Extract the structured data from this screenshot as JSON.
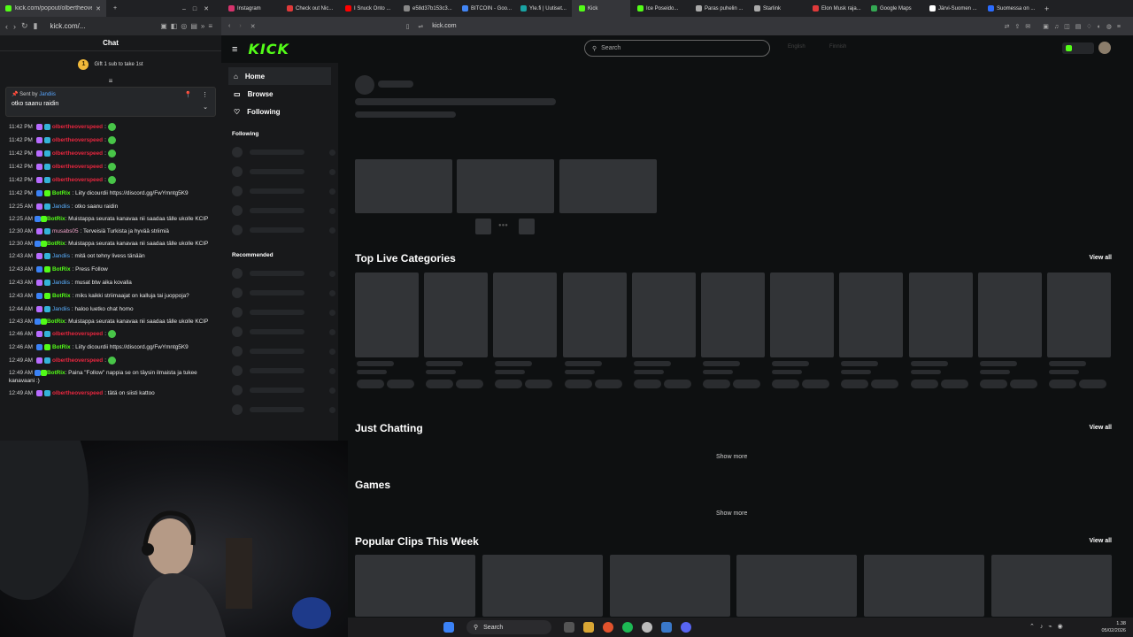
{
  "chat_window": {
    "tab_title": "kick.com/popout/olbertheovers...",
    "url": "kick.com/...",
    "title": "Chat",
    "gift_text": "Gift 1 sub to take 1st",
    "pinned": {
      "by_label": "Sent by",
      "by_user": "Jandiis",
      "message": "otko saanu raidin"
    },
    "messages": [
      {
        "time": "11:42 PM",
        "user": "olbertheoverspeed",
        "user_color": "red",
        "text": ":",
        "emote": true
      },
      {
        "time": "11:42 PM",
        "user": "olbertheoverspeed",
        "user_color": "red",
        "text": ":",
        "emote": true
      },
      {
        "time": "11:42 PM",
        "user": "olbertheoverspeed",
        "user_color": "red",
        "text": ":",
        "emote": true
      },
      {
        "time": "11:42 PM",
        "user": "olbertheoverspeed",
        "user_color": "red",
        "text": ":",
        "emote": true
      },
      {
        "time": "11:42 PM",
        "user": "olbertheoverspeed",
        "user_color": "red",
        "text": ":",
        "emote": true
      },
      {
        "time": "11:42 PM",
        "user": "BotRix",
        "user_color": "green",
        "text": ": Liity dicourdii https://discord.gg/FwYmntg5K9"
      },
      {
        "time": "12:25 AM",
        "user": "Jandiis",
        "user_color": "blue",
        "text": ": otko saanu raidin"
      },
      {
        "time": "12:25 AM",
        "user": "BotRix",
        "user_color": "green",
        "text": ": Muistappa seurata kanavaa nii saadaa tälle ukolle KCIP",
        "wrap": true
      },
      {
        "time": "12:30 AM",
        "user": "musabs05",
        "user_color": "pink",
        "text": ": Terveisiä Turkista ja hyvää striimiä"
      },
      {
        "time": "12:30 AM",
        "user": "BotRix",
        "user_color": "green",
        "text": ": Muistappa seurata kanavaa nii saadaa tälle ukolle KCIP",
        "wrap": true
      },
      {
        "time": "12:43 AM",
        "user": "Jandiis",
        "user_color": "blue",
        "text": ": mitä oot tehny livess tänään"
      },
      {
        "time": "12:43 AM",
        "user": "BotRix",
        "user_color": "green",
        "text": ": Press Follow"
      },
      {
        "time": "12:43 AM",
        "user": "Jandiis",
        "user_color": "blue",
        "text": ": musat btw aika kovalla"
      },
      {
        "time": "12:43 AM",
        "user": "BotRix",
        "user_color": "green",
        "text": ": miks kaikki striimaajat on kalluja tai juoppoja?"
      },
      {
        "time": "12:44 AM",
        "user": "Jandiis",
        "user_color": "blue",
        "text": ": haloo luetko chat homo"
      },
      {
        "time": "12:43 AM",
        "user": "BotRix",
        "user_color": "green",
        "text": ": Muistappa seurata kanavaa nii saadaa tälle ukolle KCIP",
        "wrap": true
      },
      {
        "time": "12:46 AM",
        "user": "olbertheoverspeed",
        "user_color": "red",
        "text": ":",
        "emote": true
      },
      {
        "time": "12:46 AM",
        "user": "BotRix",
        "user_color": "green",
        "text": ": Liity dicourdii https://discord.gg/FwYmntg5K9"
      },
      {
        "time": "12:49 AM",
        "user": "olbertheoverspeed",
        "user_color": "red",
        "text": ":",
        "emote": true
      },
      {
        "time": "12:49 AM",
        "user": "BotRix",
        "user_color": "green",
        "text": ": Paina \"Follow\" nappia se on täysin ilmaista ja tukee kanavaani :)",
        "wrap": true
      },
      {
        "time": "12:49 AM",
        "user": "olbertheoverspeed",
        "user_color": "red",
        "text": ": tätä on siisti kattoo"
      }
    ]
  },
  "browser": {
    "tabs": [
      {
        "label": "Instagram",
        "color": "#d6336c"
      },
      {
        "label": "Check out Nic...",
        "color": "#e03a3a"
      },
      {
        "label": "I Snuck Onto ...",
        "color": "#ff0000"
      },
      {
        "label": "e58d37b153c3...",
        "color": "#888888"
      },
      {
        "label": "BITCOIN - Goo...",
        "color": "#4285f4"
      },
      {
        "label": "Yle.fi | Uutiset...",
        "color": "#19a3a3"
      },
      {
        "label": "Kick",
        "color": "#53fc18",
        "active": true
      },
      {
        "label": "Ice Poseido...",
        "color": "#53fc18"
      },
      {
        "label": "Paras puhelin ...",
        "color": "#aaaaaa"
      },
      {
        "label": "Starlink",
        "color": "#aaaaaa"
      },
      {
        "label": "Elon Musk raja...",
        "color": "#e03a3a"
      },
      {
        "label": "Google Maps",
        "color": "#34a853"
      },
      {
        "label": "Järvi-Suomen ...",
        "color": "#ffffff"
      },
      {
        "label": "Suomessa on ...",
        "color": "#2b6cff"
      }
    ],
    "url": "kick.com"
  },
  "site": {
    "logo": "KICK",
    "search_placeholder": "Search",
    "lang1": "English",
    "lang2": "Finnish",
    "nav": {
      "home": "Home",
      "browse": "Browse",
      "following": "Following"
    },
    "following_heading": "Following",
    "recommended_heading": "Recommended",
    "sections": {
      "top_live": "Top Live Categories",
      "just_chatting": "Just Chatting",
      "games": "Games",
      "clips": "Popular Clips This Week",
      "view_all": "View all",
      "show_more": "Show more"
    }
  },
  "taskbar": {
    "search_label": "Search",
    "time": "1.38",
    "date": "05/02/2026"
  }
}
